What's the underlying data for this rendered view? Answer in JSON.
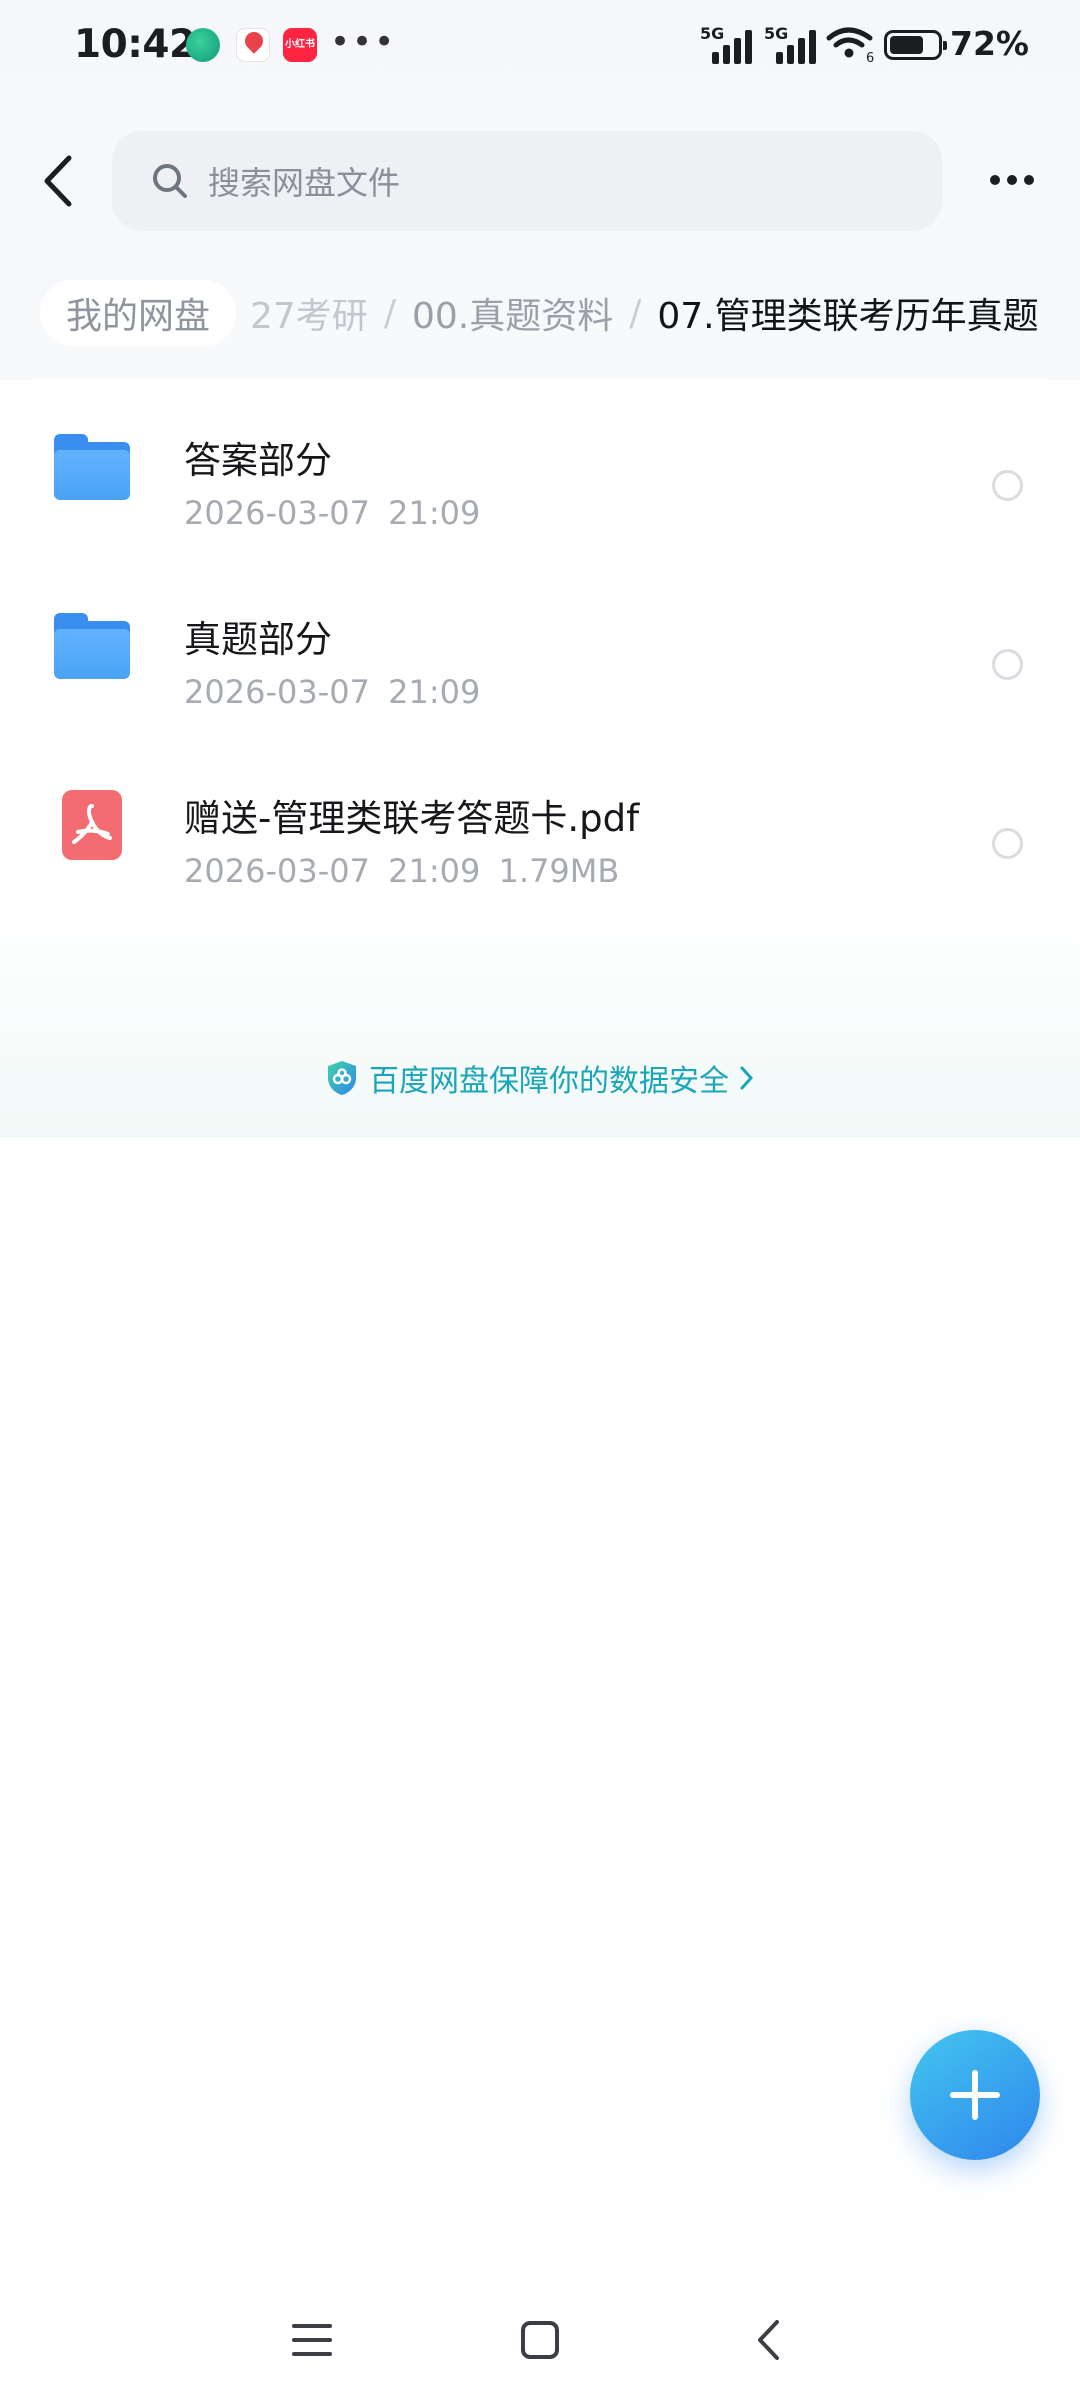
{
  "status_bar": {
    "time": "10:42",
    "app_icons": [
      "globe-icon",
      "map-pin-icon",
      "xiaohongshu-icon"
    ],
    "xhs_label": "小红书",
    "more": "•••",
    "signal1_label": "5G",
    "signal2_label": "5G",
    "wifi_label": "6",
    "battery_level": 0.72,
    "battery_text": "72%"
  },
  "header": {
    "back_icon": "back-chevron-icon",
    "search_placeholder": "搜索网盘文件",
    "more_icon": "more-dots-icon"
  },
  "breadcrumb": {
    "root": "我的网盘",
    "items": [
      {
        "label": "27考研",
        "state": "faded"
      },
      {
        "label": "00.真题资料",
        "state": "normal"
      },
      {
        "label": "07.管理类联考历年真题",
        "state": "current"
      }
    ],
    "separator": "/"
  },
  "files": [
    {
      "name": "答案部分",
      "date": "2026-03-07",
      "time": "21:09",
      "size": "",
      "type": "folder"
    },
    {
      "name": "真题部分",
      "date": "2026-03-07",
      "time": "21:09",
      "size": "",
      "type": "folder"
    },
    {
      "name": "赠送-管理类联考答题卡.pdf",
      "date": "2026-03-07",
      "time": "21:09",
      "size": "1.79MB",
      "type": "pdf"
    }
  ],
  "security_banner": {
    "text": "百度网盘保障你的数据安全",
    "icon": "shield-icon"
  },
  "fab": {
    "icon": "plus-icon"
  },
  "nav_bar": {
    "icons": [
      "menu-icon",
      "home-icon",
      "back-icon"
    ]
  },
  "colors": {
    "accent": "#2f86ec",
    "folder": "#4aa2f5",
    "pdf": "#f36c72",
    "security_text": "#1aa6b7"
  }
}
